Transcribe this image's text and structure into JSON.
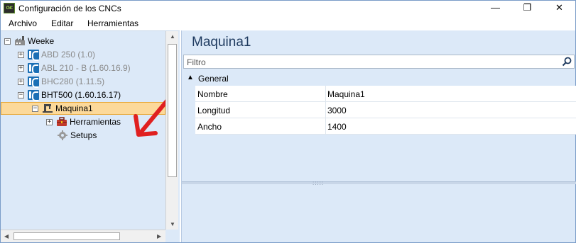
{
  "window": {
    "title": "Configuración de los CNCs",
    "app_icon_text": "CNC"
  },
  "controls": {
    "minimize": "—",
    "maximize": "❐",
    "close": "✕"
  },
  "menu": [
    {
      "label": "Archivo"
    },
    {
      "label": "Editar"
    },
    {
      "label": "Herramientas"
    }
  ],
  "tree": {
    "root": {
      "label": "Weeke",
      "expander": "−"
    },
    "machines": [
      {
        "label": "ABD 250 (1.0)",
        "expander": "+",
        "dimmed": true
      },
      {
        "label": "ABL 210 - B (1.60.16.9)",
        "expander": "+",
        "dimmed": true
      },
      {
        "label": "BHC280 (1.11.5)",
        "expander": "+",
        "dimmed": true
      },
      {
        "label": "BHT500 (1.60.16.17)",
        "expander": "−",
        "dimmed": false
      }
    ],
    "selected": {
      "label": "Maquina1",
      "expander": "−"
    },
    "children": [
      {
        "label": "Herramientas",
        "expander": "+"
      },
      {
        "label": "Setups"
      }
    ]
  },
  "details": {
    "title": "Maquina1",
    "filter_placeholder": "Filtro",
    "group": {
      "label": "General",
      "arrow": "▲"
    },
    "properties": [
      {
        "name": "Nombre",
        "value": "Maquina1"
      },
      {
        "name": "Longitud",
        "value": "3000"
      },
      {
        "name": "Ancho",
        "value": "1400"
      }
    ]
  },
  "colors": {
    "pane_background": "#dce9f8",
    "selection_background": "#fcd99a",
    "selection_border": "#e8a93a",
    "annotation_arrow": "#e02020",
    "title_text": "#1e3a5f"
  }
}
